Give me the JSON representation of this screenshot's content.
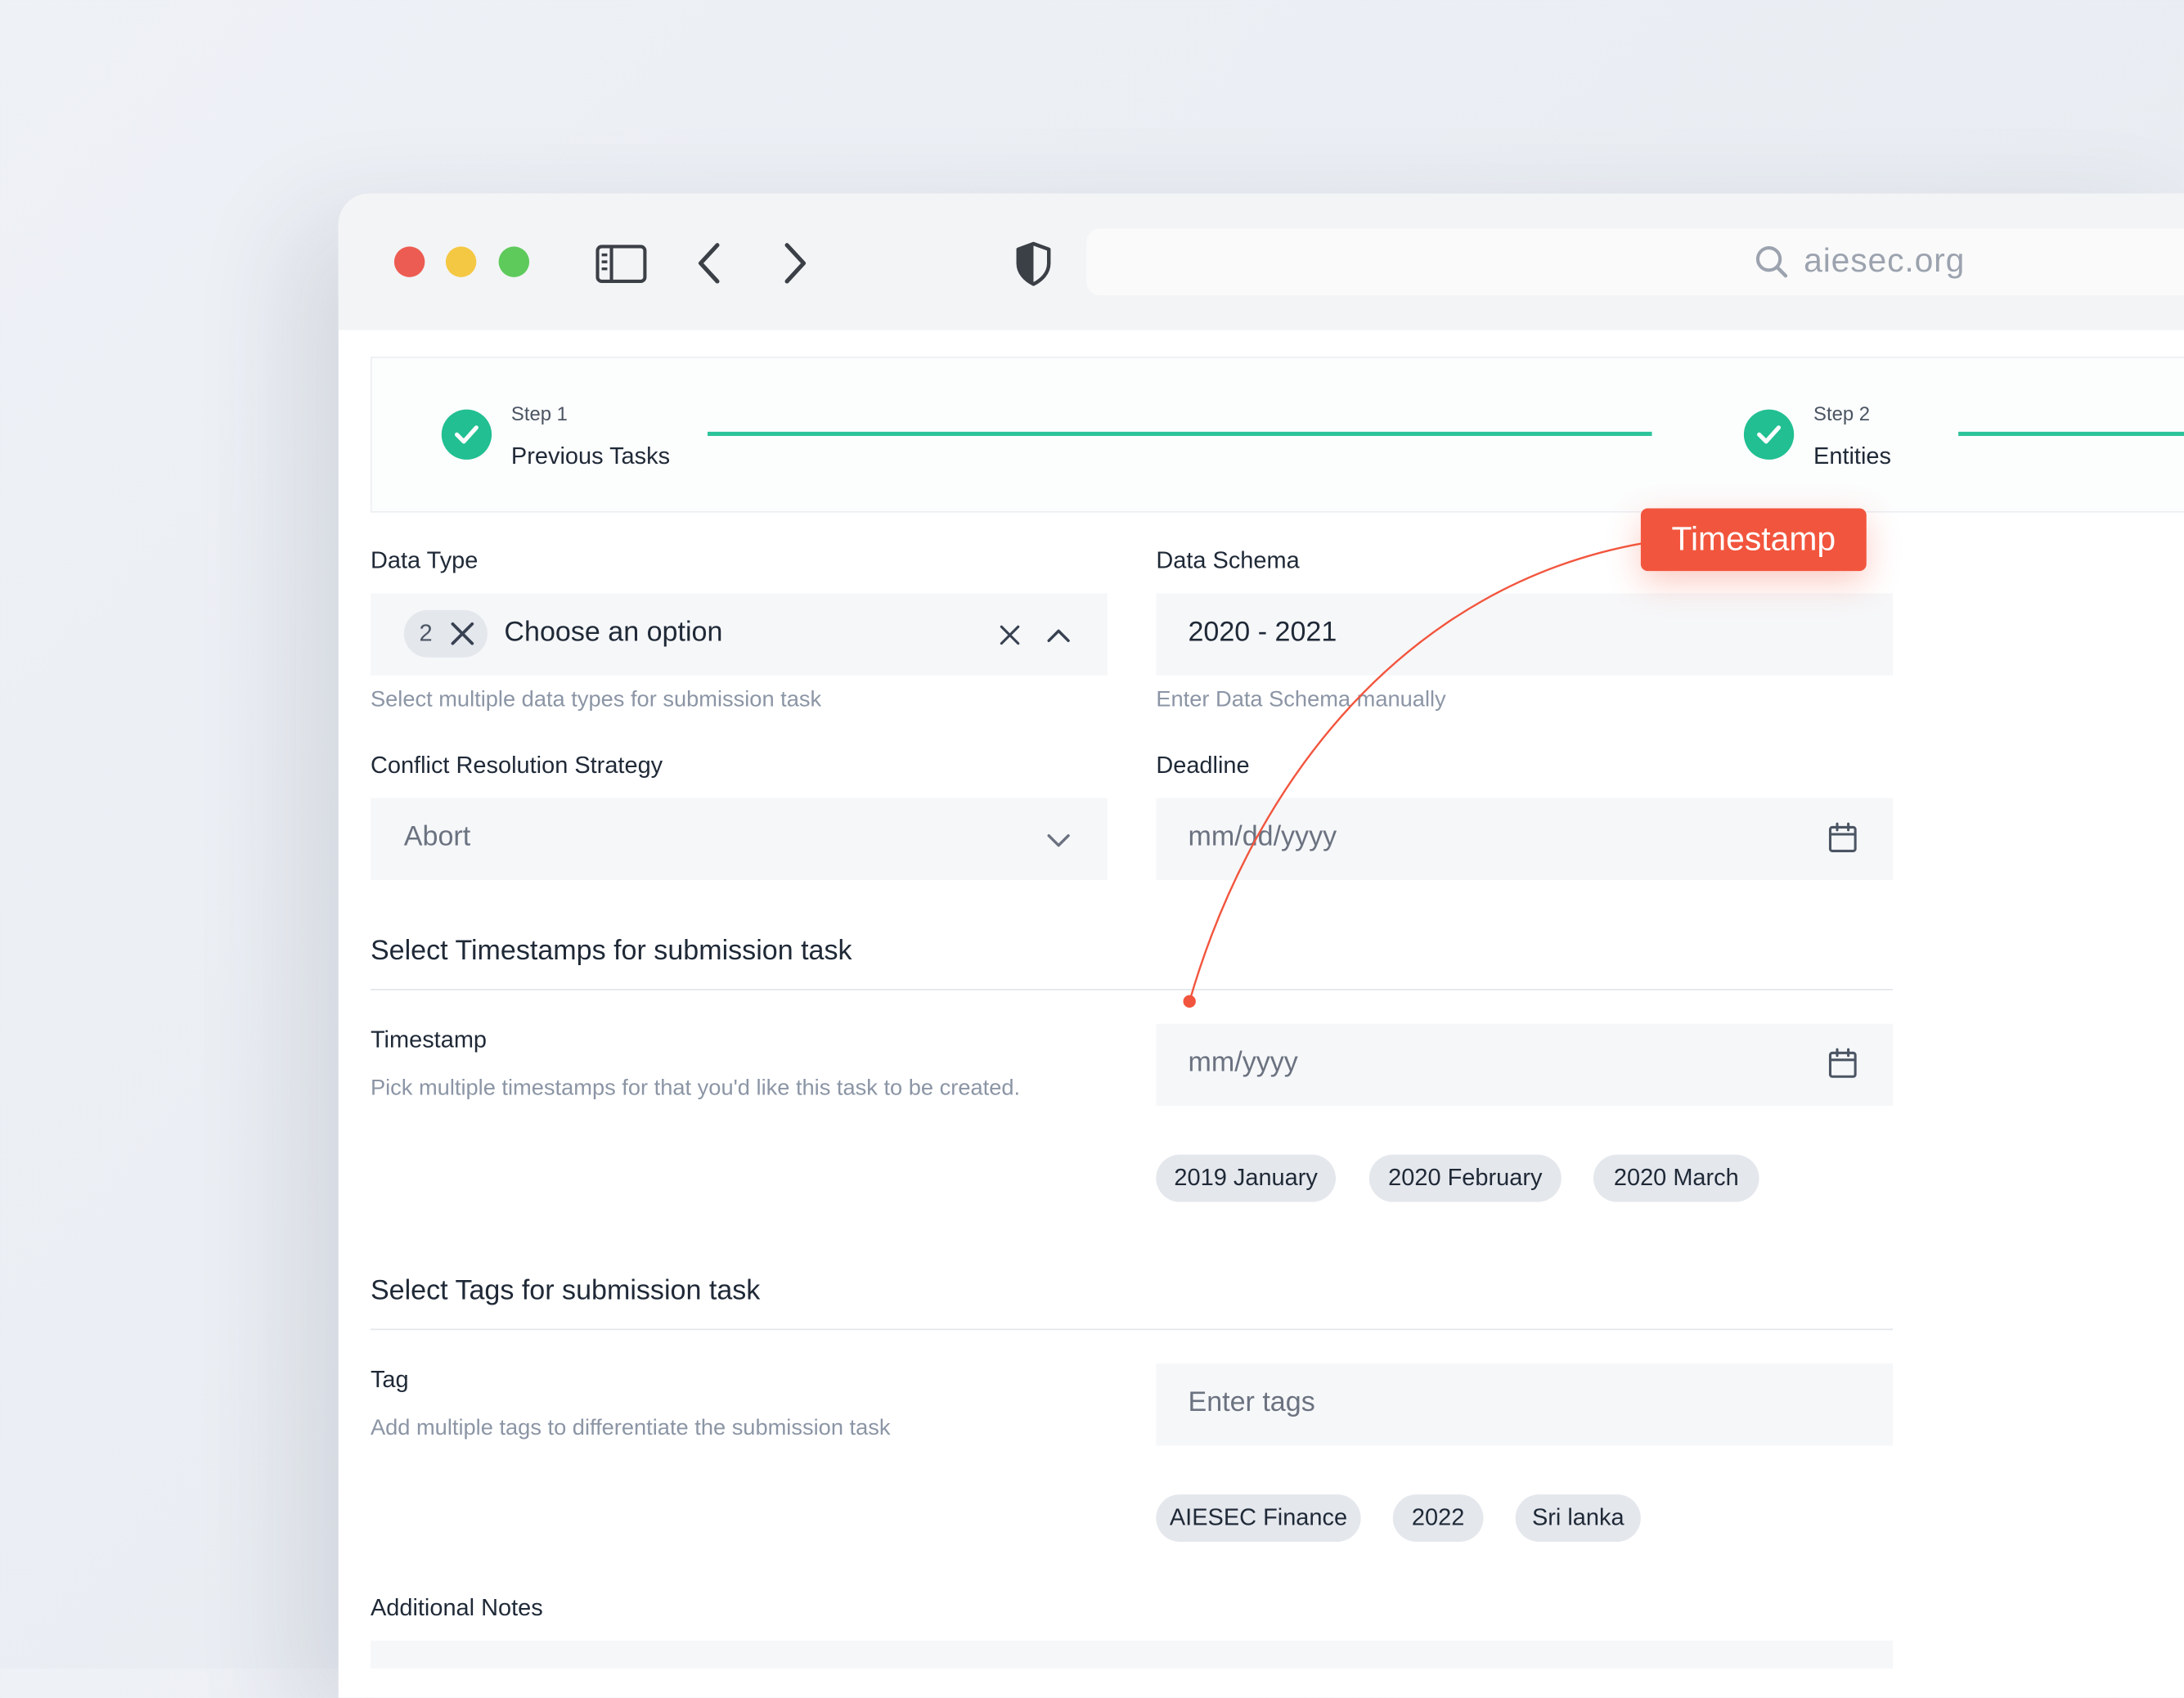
{
  "browser": {
    "url": "aiesec.org"
  },
  "stepper": {
    "steps": [
      {
        "step": "Step 1",
        "title": "Previous Tasks"
      },
      {
        "step": "Step 2",
        "title": "Entities"
      }
    ]
  },
  "form": {
    "data_type": {
      "label": "Data Type",
      "count": "2",
      "placeholder": "Choose an option",
      "help": "Select multiple data types for submission task"
    },
    "data_schema": {
      "label": "Data Schema",
      "value": "2020 - 2021",
      "help": "Enter Data Schema manually"
    },
    "conflict": {
      "label": "Conflict Resolution Strategy",
      "value": "Abort"
    },
    "deadline": {
      "label": "Deadline",
      "placeholder": "mm/dd/yyyy"
    },
    "timestamps_section": {
      "title": "Select Timestamps for submission task",
      "label": "Timestamp",
      "help": "Pick multiple timestamps for that you'd like this task to be created.",
      "placeholder": "mm/yyyy",
      "chips": [
        "2019 January",
        "2020 February",
        "2020 March"
      ]
    },
    "tags_section": {
      "title": "Select Tags for submission task",
      "label": "Tag",
      "help": "Add multiple tags to differentiate the submission task",
      "placeholder": "Enter tags",
      "chips": [
        "AIESEC Finance",
        "2022",
        "Sri lanka"
      ]
    },
    "notes": {
      "label": "Additional Notes"
    }
  },
  "annotation": {
    "label": "Timestamp"
  },
  "colors": {
    "accent_green": "#21bf92",
    "callout_red": "#f2553d",
    "close_red": "#ed5c52",
    "minimize_yellow": "#f5c843",
    "maximize_green": "#5dca5b"
  }
}
